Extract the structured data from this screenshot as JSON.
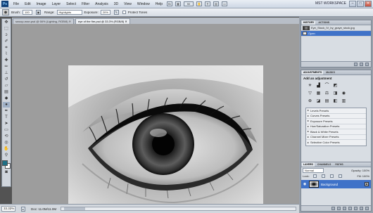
{
  "app": {
    "logo": "Ps"
  },
  "menu": {
    "items": [
      "File",
      "Edit",
      "Image",
      "Layer",
      "Select",
      "Filter",
      "Analysis",
      "3D",
      "View",
      "Window",
      "Help"
    ],
    "zoom_indicator": "50",
    "workspace": "MST WORKSPACE"
  },
  "window_buttons": {
    "minimize": "–",
    "maximize": "□",
    "close": "✕"
  },
  "options": {
    "brush_label": "Brush:",
    "brush_size": "100",
    "range_label": "Range:",
    "range_value": "Highlights",
    "exposure_label": "Exposure:",
    "exposure_value": "20%",
    "protect_tones_label": "Protect Tones"
  },
  "doc_tabs": [
    {
      "label": "swoop-man.psd @ 66% (Lighting, RGB/8) ✕",
      "active": false
    },
    {
      "label": "eye of the fire.psd @ 33.3% (RGB/8) ✕",
      "active": true
    }
  ],
  "status": {
    "zoom": "33.33%",
    "doc_info": "Doc: 11.0M/11.0M"
  },
  "history_panel": {
    "tabs": [
      "HISTORY",
      "ACTIONS"
    ],
    "snapshot_label": "Eye_Stock_IV_by_graye_stock.jpg",
    "states": [
      "Open"
    ]
  },
  "adjustments_panel": {
    "tabs": [
      "ADJUSTMENTS",
      "MASKS"
    ],
    "title": "Add an adjustment",
    "presets": [
      "Levels Presets",
      "Curves Presets",
      "Exposure Presets",
      "Hue/Saturation Presets",
      "Black & White Presets",
      "Channel Mixer Presets",
      "Selective Color Presets"
    ]
  },
  "layers_panel": {
    "tabs": [
      "LAYERS",
      "CHANNELS",
      "PATHS"
    ],
    "blend_mode": "Normal",
    "opacity": "Opacity: 100%",
    "lock_label": "Lock:",
    "fill": "Fill: 100%",
    "layer_name": "Background"
  },
  "colors": {
    "selection": "#3f72c8",
    "canvas_bg": "#9d9d9d",
    "chrome": "#d8dde3"
  }
}
